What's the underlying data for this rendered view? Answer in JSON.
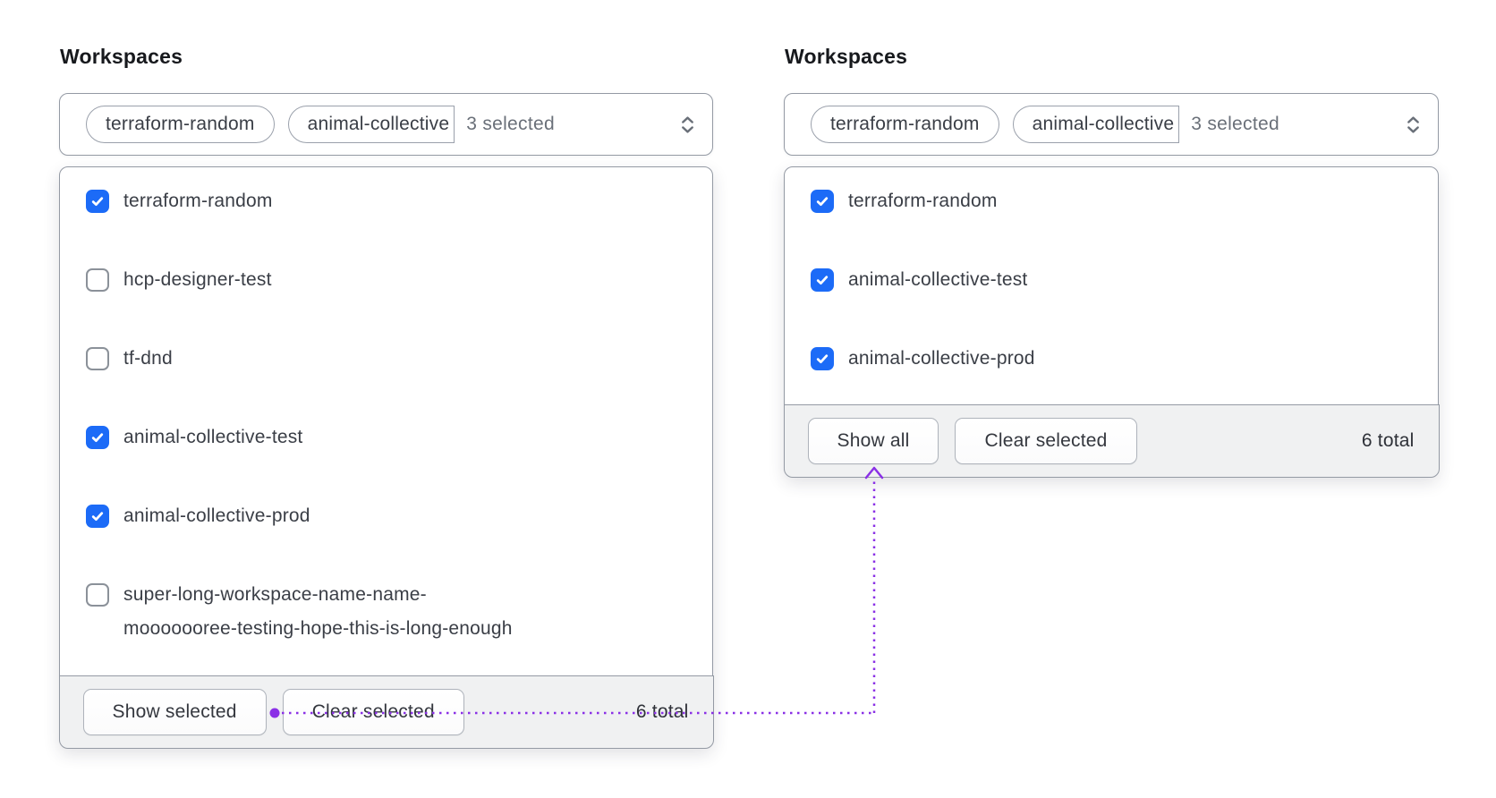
{
  "colors": {
    "checkbox_checked_blue": "#1c6bf7",
    "annotation_purple": "#8a30e6",
    "footer_background": "#f0f1f2",
    "panel_border": "#949aa4"
  },
  "left": {
    "title": "Workspaces",
    "selector": {
      "pills": [
        {
          "label": "terraform-random"
        },
        {
          "label": "animal-collective"
        }
      ],
      "count_label": "3 selected"
    },
    "items": [
      {
        "label": "terraform-random",
        "checked": true
      },
      {
        "label": "hcp-designer-test",
        "checked": false
      },
      {
        "label": "tf-dnd",
        "checked": false
      },
      {
        "label": "animal-collective-test",
        "checked": true
      },
      {
        "label": "animal-collective-prod",
        "checked": true
      },
      {
        "label": "super-long-workspace-name-name-\nmooooooree-testing-hope-this-is-long-enough",
        "checked": false
      }
    ],
    "footer": {
      "show_button": "Show selected",
      "clear_button": "Clear selected",
      "total": "6 total"
    }
  },
  "right": {
    "title": "Workspaces",
    "selector": {
      "pills": [
        {
          "label": "terraform-random"
        },
        {
          "label": "animal-collective"
        }
      ],
      "count_label": "3 selected"
    },
    "items": [
      {
        "label": "terraform-random",
        "checked": true
      },
      {
        "label": "animal-collective-test",
        "checked": true
      },
      {
        "label": "animal-collective-prod",
        "checked": true
      }
    ],
    "footer": {
      "show_button": "Show all",
      "clear_button": "Clear selected",
      "total": "6 total"
    }
  }
}
